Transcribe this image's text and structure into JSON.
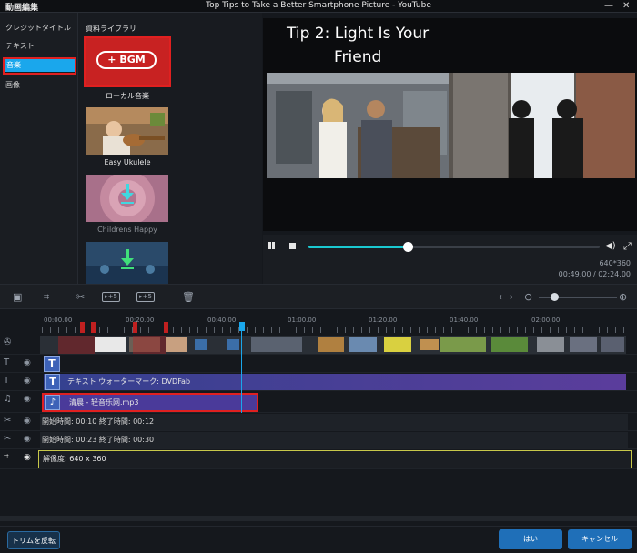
{
  "window": {
    "app_title": "動画編集",
    "title": "Top Tips to Take a Better Smartphone Picture - YouTube",
    "controls": [
      "—",
      "✕"
    ]
  },
  "sidebar": {
    "items": [
      {
        "label": "クレジットタイトル"
      },
      {
        "label": "テキスト"
      },
      {
        "label": "音楽"
      },
      {
        "label": "画像"
      }
    ],
    "active": "音楽"
  },
  "library": {
    "title": "資料ライブラリ",
    "bgm_button": "+ BGM",
    "items": [
      {
        "label": "ローカル音楽"
      },
      {
        "label": "Easy Ukulele"
      },
      {
        "label": "Childrens Happy"
      }
    ]
  },
  "preview": {
    "caption_line1": "Tip 2: Light Is Your",
    "caption_line2": "Friend",
    "resolution": "640*360",
    "time": "00:49.00 / 02:24.00",
    "progress": 0.34
  },
  "timeline": {
    "ticks": [
      "00:00.00",
      "00:20.00",
      "00:40.00",
      "01:00.00",
      "01:20.00",
      "01:40.00",
      "02:00.00"
    ],
    "zoom": 0.2,
    "tracks": {
      "text_watermark": "テキスト ウォーターマーク: DVDFab",
      "audio": "清晨 - 轻音乐网.mp3",
      "trim1": "開始時間: 00:10   終了時間: 00:12",
      "trim2": "開始時間: 00:23   終了時間: 00:30",
      "crop": "解像度: 640 x 360"
    },
    "labels": {
      "t1": "T",
      "t2": "T"
    }
  },
  "footer": {
    "invert_trim": "トリムを反転",
    "ok": "はい",
    "cancel": "キャンセル"
  },
  "colors": {
    "accent": "#1aa7ec",
    "highlight": "#e02020",
    "text_bar": "#3c4aa0",
    "audio_bar": "#4a3aa0"
  }
}
